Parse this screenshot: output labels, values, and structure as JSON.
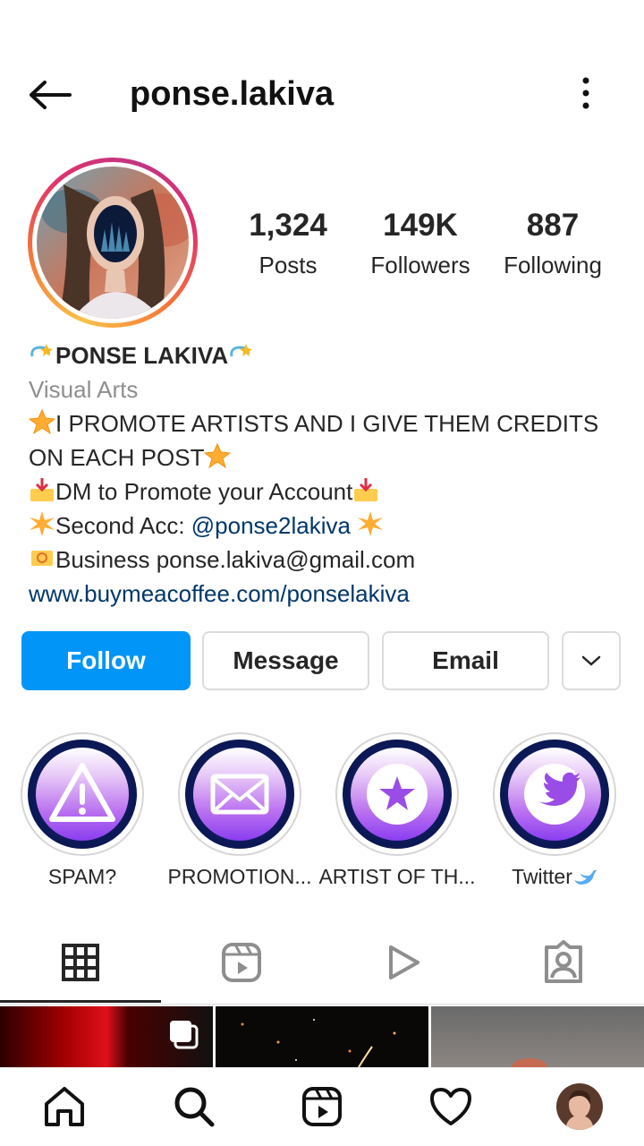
{
  "header": {
    "username": "ponse.lakiva"
  },
  "stats": [
    {
      "value": "1,324",
      "label": "Posts"
    },
    {
      "value": "149K",
      "label": "Followers"
    },
    {
      "value": "887",
      "label": "Following"
    }
  ],
  "bio": {
    "display_name": "PONSE LAKIVA",
    "category": "Visual Arts",
    "line1": "I PROMOTE ARTISTS AND I GIVE THEM CREDITS",
    "line2": "ON EACH POST",
    "line3": "DM to Promote your Account",
    "line4_prefix": "Second Acc: ",
    "line4_handle": "@ponse2lakiva",
    "line5": "Business ponse.lakiva@gmail.com",
    "website": "www.buymeacoffee.com/ponselakiva"
  },
  "actions": {
    "follow": "Follow",
    "message": "Message",
    "email": "Email"
  },
  "highlights": [
    {
      "label": "SPAM?",
      "icon": "warning-icon"
    },
    {
      "label": "PROMOTION...",
      "icon": "envelope-icon"
    },
    {
      "label": "ARTIST OF TH...",
      "icon": "star-icon"
    },
    {
      "label": "Twitter",
      "icon": "twitter-icon"
    }
  ],
  "tabs": [
    "grid-icon",
    "reels-icon",
    "play-icon",
    "tagged-icon"
  ],
  "bottom_nav": [
    "home-icon",
    "search-icon",
    "reels-icon",
    "heart-icon",
    "profile-avatar"
  ],
  "colors": {
    "accent": "#0095f6",
    "link": "#00376b",
    "muted": "#8e8e8e"
  }
}
